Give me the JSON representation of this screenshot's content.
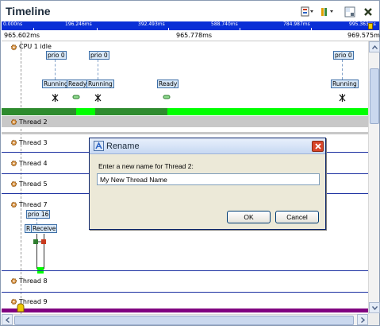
{
  "window": {
    "title": "Timeline"
  },
  "toolbar": {
    "icons": [
      "filter-icon",
      "columns-icon",
      "layout-icon",
      "close-icon"
    ]
  },
  "ruler": {
    "ticks": [
      "0.000ns",
      "196.246ms",
      "392.493ms",
      "588.740ms",
      "784.987ms",
      "995.363ms"
    ]
  },
  "time_range": {
    "start": "965.602ms",
    "center": "965.778ms",
    "end": "969.575ms"
  },
  "cpu_lane": {
    "label": "CPU 1 idle",
    "prio_labels": [
      "prio 0",
      "prio 0",
      "prio 0"
    ],
    "state_labels": [
      "Running",
      "Ready",
      "Running",
      "Ready",
      "Running"
    ],
    "bar_color": "#00ff00",
    "bar_dark_color": "#2e8b2e"
  },
  "threads": [
    {
      "label": "Thread 2",
      "selected": true
    },
    {
      "label": "Thread 3"
    },
    {
      "label": "Thread 4"
    },
    {
      "label": "Thread 5"
    },
    {
      "label": "Thread 7",
      "prio": "prio 16",
      "state_labels": [
        "R",
        "Receive"
      ]
    },
    {
      "label": "Thread 8"
    },
    {
      "label": "Thread 9"
    }
  ],
  "lane_line_color": "#1a2ea0",
  "dialog": {
    "title": "Rename",
    "prompt": "Enter a new name for Thread 2:",
    "input_value": "My New Thread Name",
    "ok_label": "OK",
    "cancel_label": "Cancel"
  }
}
